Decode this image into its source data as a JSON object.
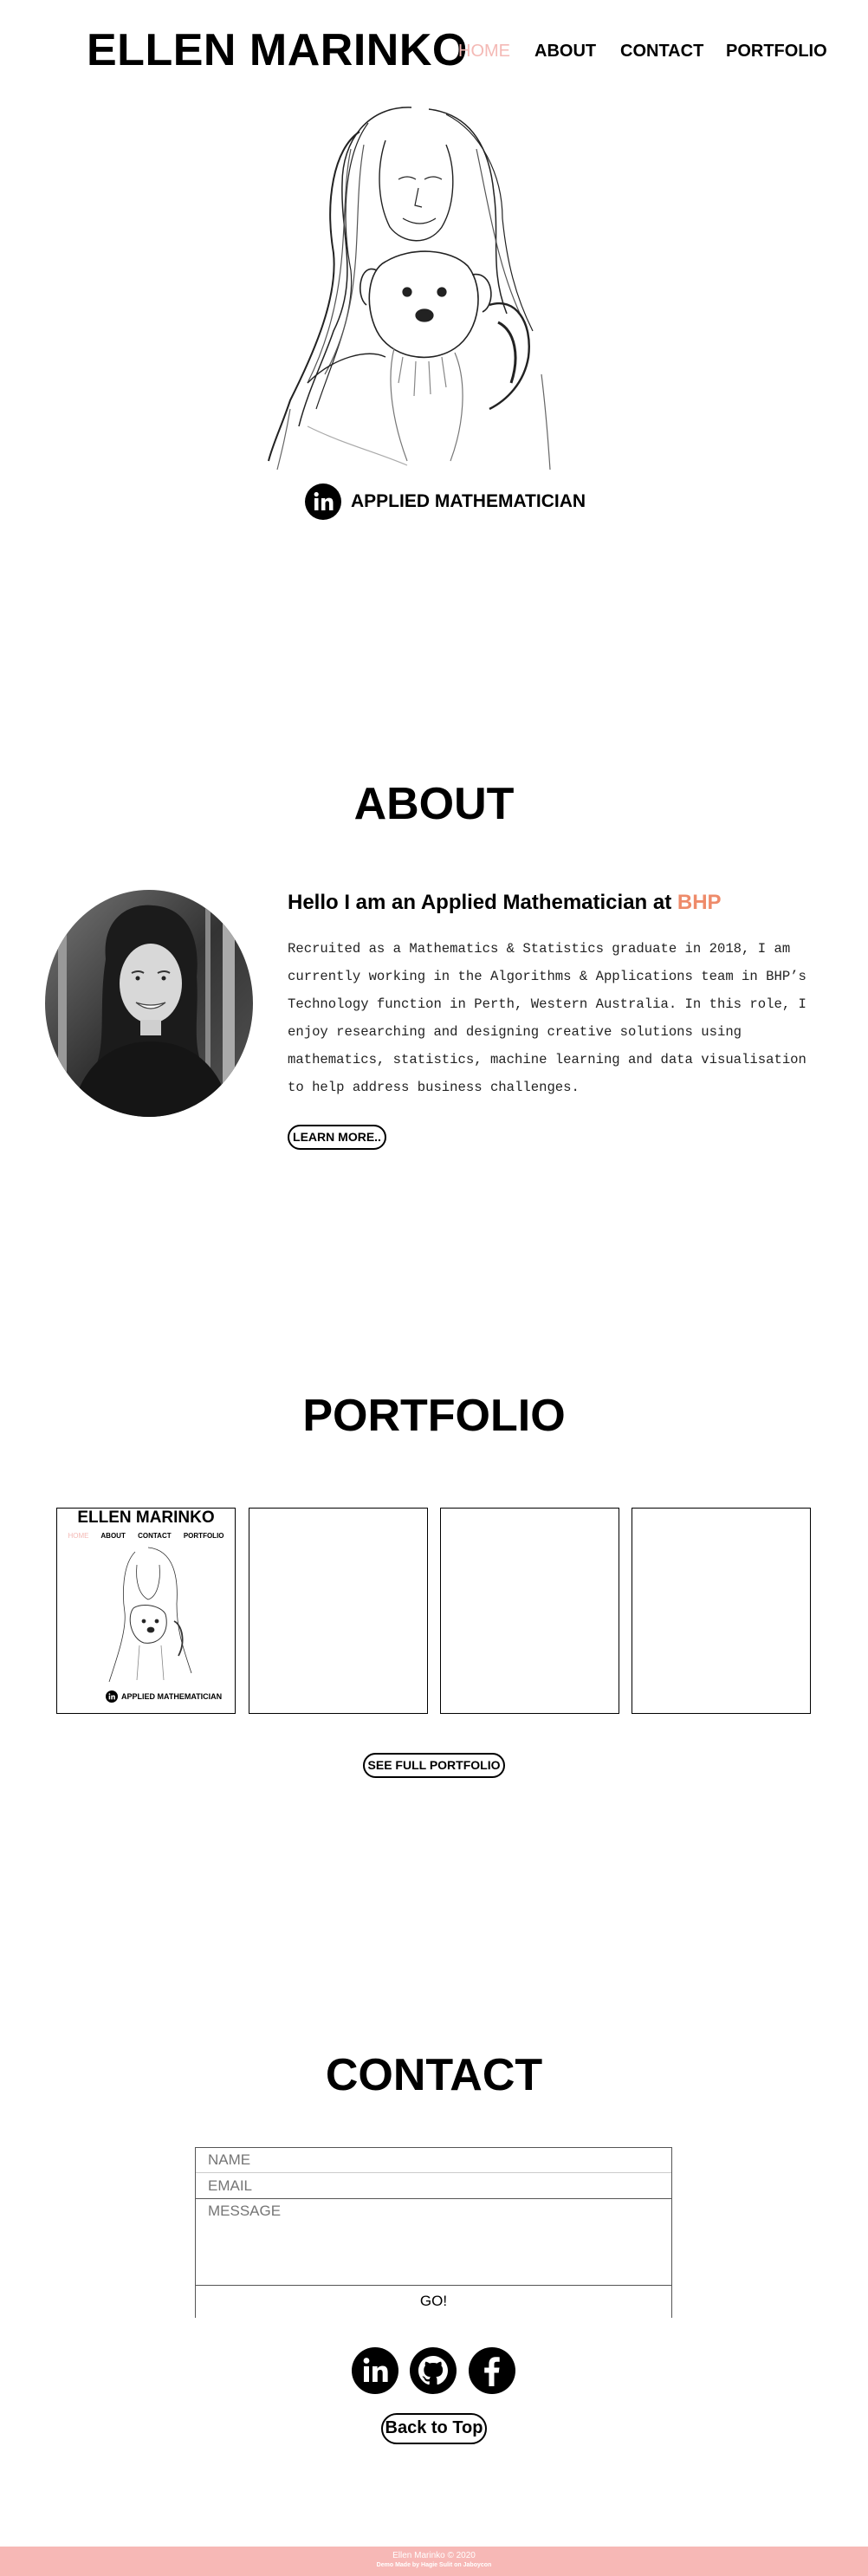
{
  "header": {
    "site_title": "ELLEN MARINKO",
    "nav": [
      "HOME",
      "ABOUT",
      "CONTACT",
      "PORTFOLIO"
    ]
  },
  "hero": {
    "subtitle": "APPLIED MATHEMATICIAN",
    "linkedin_icon": "linkedin-icon"
  },
  "about": {
    "heading": "ABOUT",
    "hello_prefix": "Hello I am an Applied Mathematician at ",
    "hello_company": "BHP",
    "body": "Recruited as a Mathematics & Statistics graduate in 2018, I am currently working in the Algorithms & Applications team in BHP’s Technology function in Perth, Western Australia. In this role, I enjoy researching and designing creative solutions using mathematics, statistics, machine learning and data visualisation to help address business challenges.",
    "learn_more": "LEARN MORE.."
  },
  "portfolio": {
    "heading": "PORTFOLIO",
    "tile_preview": {
      "title": "ELLEN MARINKO",
      "nav": [
        "HOME",
        "ABOUT",
        "CONTACT",
        "PORTFOLIO"
      ],
      "subtitle": "APPLIED MATHEMATICIAN"
    },
    "see_full": "SEE FULL PORTFOLIO"
  },
  "contact": {
    "heading": "CONTACT",
    "name_placeholder": "NAME",
    "email_placeholder": "EMAIL",
    "message_placeholder": "MESSAGE",
    "submit": "GO!",
    "social_icons": [
      "linkedin-icon",
      "github-icon",
      "facebook-icon"
    ],
    "back_to_top": "Back to Top"
  },
  "footer": {
    "line1": "Ellen Marinko © 2020",
    "line2": "Demo Made by Hagie Sulit on Jaboycon"
  },
  "colors": {
    "accent": "#ee8b6a",
    "nav_active": "#f4b9b5",
    "footer_bg": "#f7b8b6"
  }
}
